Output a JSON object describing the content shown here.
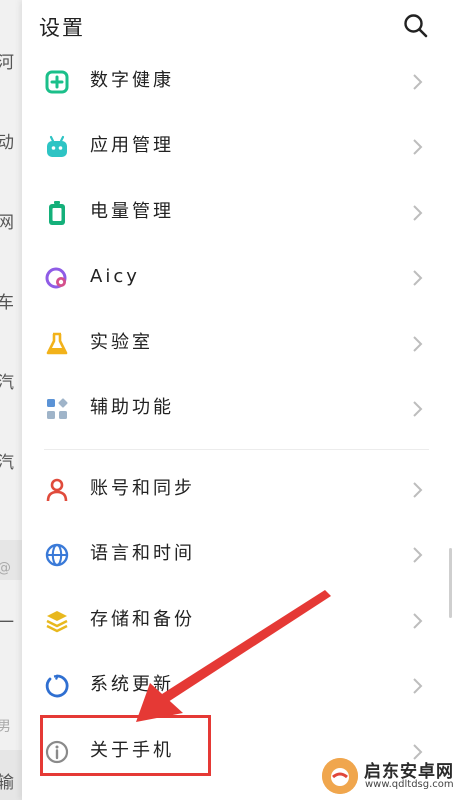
{
  "background_page": {
    "chars": [
      "河",
      "动",
      "网",
      "车",
      "汽",
      "汽",
      "@",
      "一",
      "男",
      "输"
    ]
  },
  "header": {
    "title": "设置",
    "search_icon": "search-icon"
  },
  "settings_items": [
    {
      "label": "数字健康",
      "icon": "digital-wellbeing-icon",
      "color": "#1bbf8a"
    },
    {
      "label": "应用管理",
      "icon": "app-management-icon",
      "color": "#2ec4c4"
    },
    {
      "label": "电量管理",
      "icon": "battery-icon",
      "color": "#14b07a"
    },
    {
      "label": "Aicy",
      "icon": "aicy-icon",
      "color": "#8f5ce6"
    },
    {
      "label": "实验室",
      "icon": "lab-flask-icon",
      "color": "#f2b21a"
    },
    {
      "label": "辅助功能",
      "icon": "accessibility-icon",
      "color": "#5b93d6"
    },
    {
      "label": "账号和同步",
      "icon": "account-icon",
      "color": "#e04b3c"
    },
    {
      "label": "语言和时间",
      "icon": "globe-icon",
      "color": "#3a7ad8"
    },
    {
      "label": "存储和备份",
      "icon": "storage-layers-icon",
      "color": "#e8b81e"
    },
    {
      "label": "系统更新",
      "icon": "system-update-icon",
      "color": "#2f6fd1"
    },
    {
      "label": "关于手机",
      "icon": "info-icon",
      "color": "#8a8a8a"
    }
  ],
  "annotation": {
    "highlight_color": "#e53935"
  },
  "watermark": {
    "name": "启东安卓网",
    "url": "www.qdltdsg.com"
  }
}
